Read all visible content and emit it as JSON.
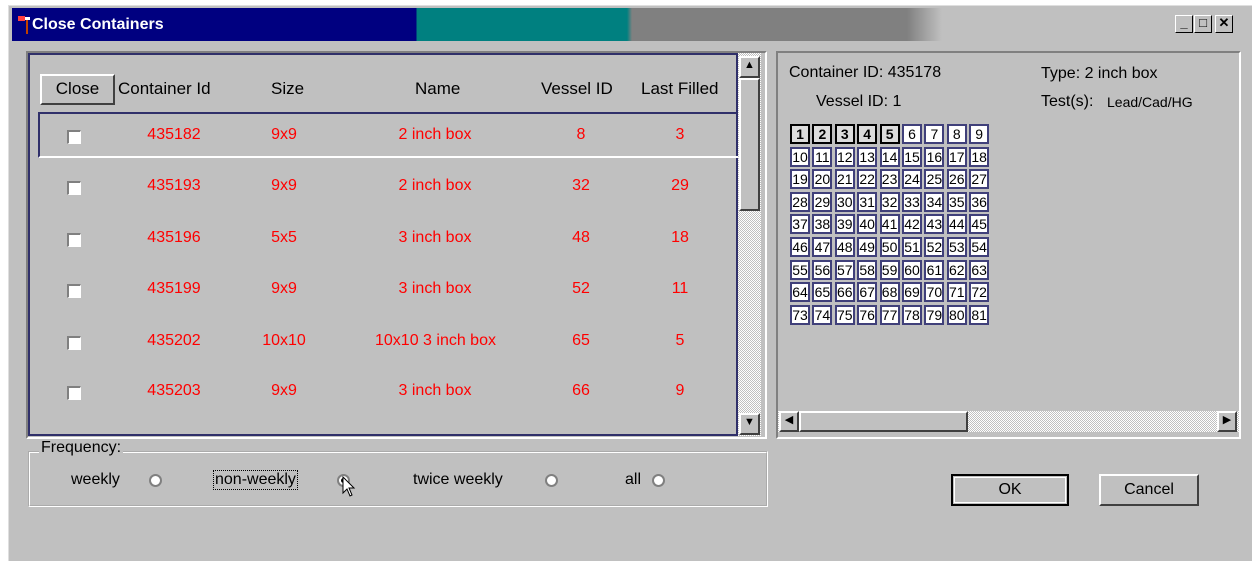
{
  "window": {
    "title": "Close Containers",
    "minimize": "_",
    "maximize": "□",
    "close": "✕"
  },
  "table": {
    "columns": {
      "close": "Close",
      "container_id": "Container Id",
      "size": "Size",
      "name": "Name",
      "vessel_id": "Vessel ID",
      "last_filled": "Last Filled"
    },
    "rows": [
      {
        "container_id": "435182",
        "size": "9x9",
        "name": "2 inch box",
        "vessel_id": "8",
        "last_filled": "3",
        "checked": false
      },
      {
        "container_id": "435193",
        "size": "9x9",
        "name": "2 inch box",
        "vessel_id": "32",
        "last_filled": "29",
        "checked": false
      },
      {
        "container_id": "435196",
        "size": "5x5",
        "name": "3 inch box",
        "vessel_id": "48",
        "last_filled": "18",
        "checked": false
      },
      {
        "container_id": "435199",
        "size": "9x9",
        "name": "3 inch box",
        "vessel_id": "52",
        "last_filled": "11",
        "checked": false
      },
      {
        "container_id": "435202",
        "size": "10x10",
        "name": "10x10 3 inch box",
        "vessel_id": "65",
        "last_filled": "5",
        "checked": false
      },
      {
        "container_id": "435203",
        "size": "9x9",
        "name": "3 inch box",
        "vessel_id": "66",
        "last_filled": "9",
        "checked": false
      }
    ]
  },
  "details": {
    "container_id_label": "Container ID: 435178",
    "type_label": "Type: 2 inch box",
    "vessel_id_label": "Vessel ID: 1",
    "tests_label": "Test(s):",
    "tests_value": "Lead/Cad/HG",
    "filled_positions": [
      1,
      2,
      3,
      4,
      5
    ],
    "positions": [
      1,
      2,
      3,
      4,
      5,
      6,
      7,
      8,
      9,
      10,
      11,
      12,
      13,
      14,
      15,
      16,
      17,
      18,
      19,
      20,
      21,
      22,
      23,
      24,
      25,
      26,
      27,
      28,
      29,
      30,
      31,
      32,
      33,
      34,
      35,
      36,
      37,
      38,
      39,
      40,
      41,
      42,
      43,
      44,
      45,
      46,
      47,
      48,
      49,
      50,
      51,
      52,
      53,
      54,
      55,
      56,
      57,
      58,
      59,
      60,
      61,
      62,
      63,
      64,
      65,
      66,
      67,
      68,
      69,
      70,
      71,
      72,
      73,
      74,
      75,
      76,
      77,
      78,
      79,
      80,
      81
    ]
  },
  "frequency": {
    "label": "Frequency:",
    "options": [
      {
        "label": "weekly",
        "selected": false
      },
      {
        "label": "non-weekly",
        "selected": true
      },
      {
        "label": "twice weekly",
        "selected": false
      },
      {
        "label": "all",
        "selected": false
      }
    ]
  },
  "buttons": {
    "ok": "OK",
    "cancel": "Cancel"
  },
  "colors": {
    "row_text": "#ff0000",
    "title_bar": "#000080"
  }
}
